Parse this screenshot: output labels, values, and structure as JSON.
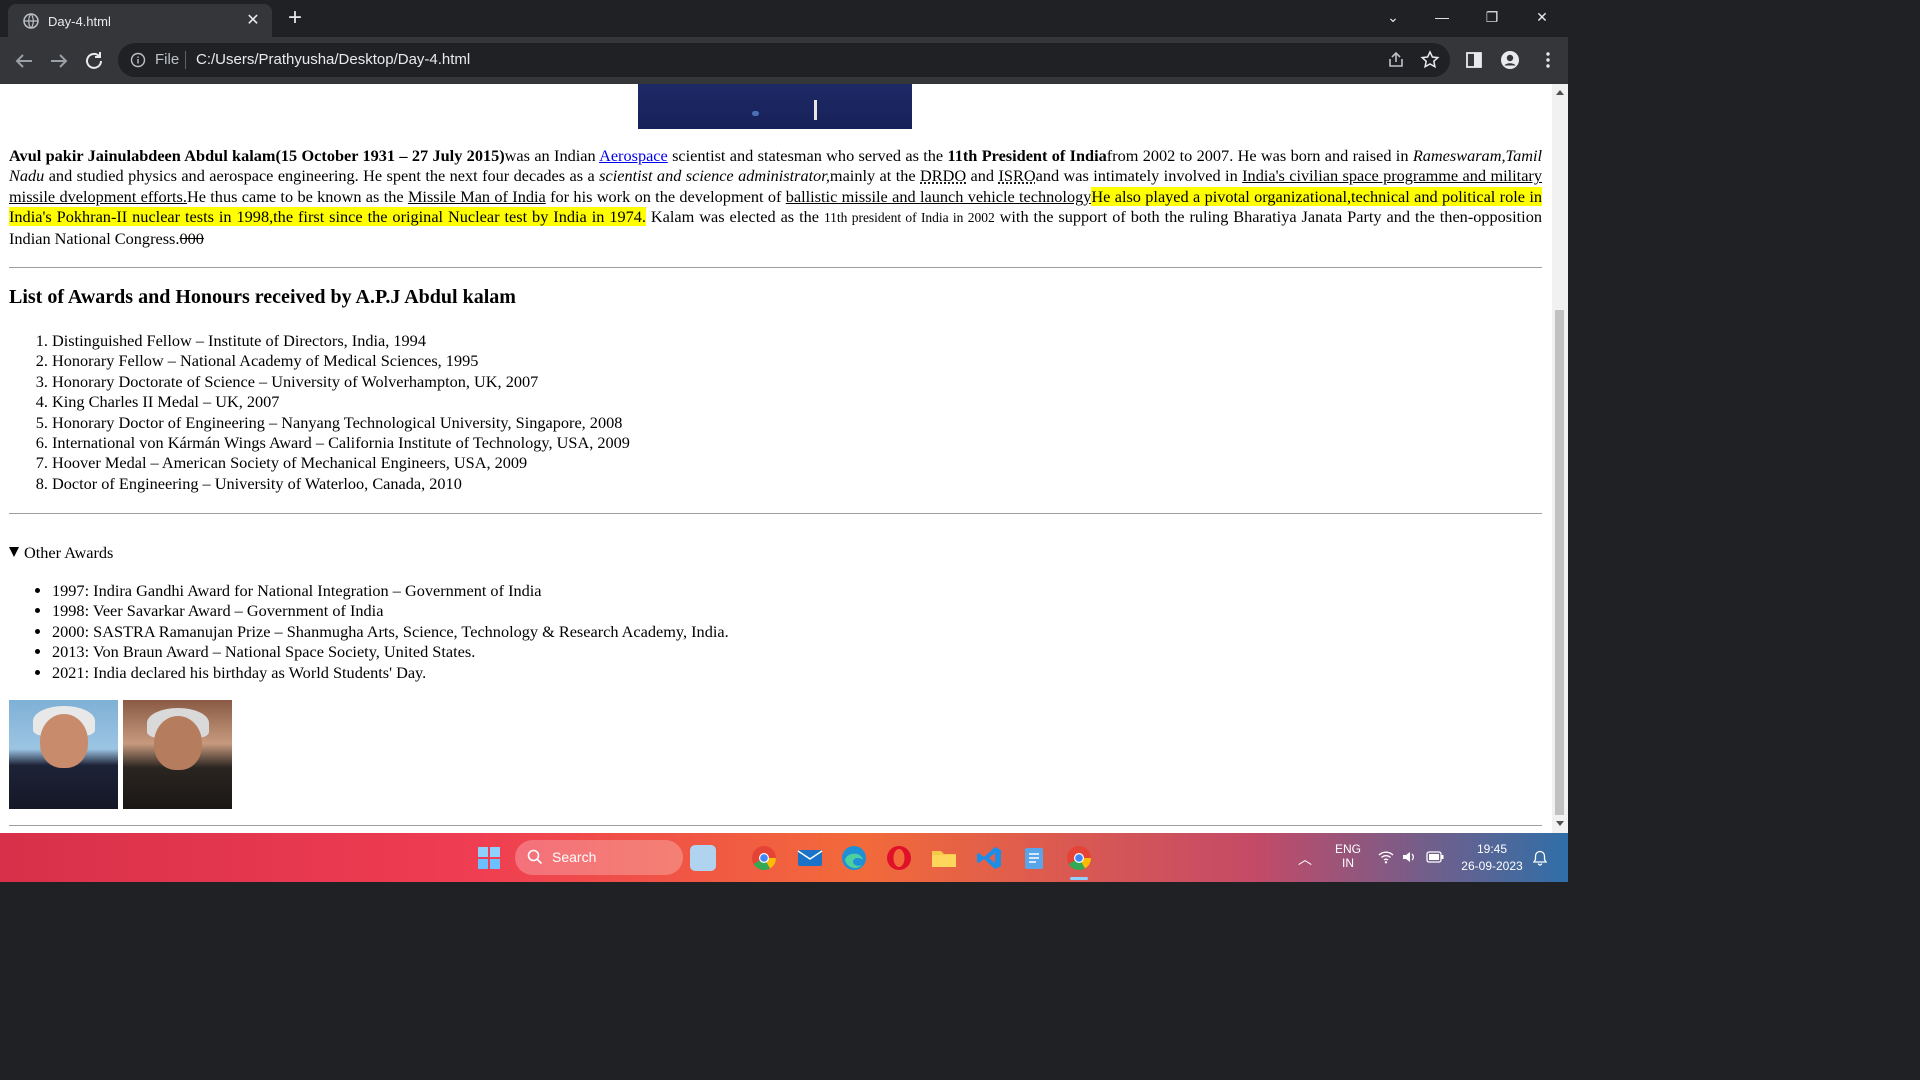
{
  "browser": {
    "tab_title": "Day-4.html",
    "omnibox_scheme": "File",
    "omnibox_url": "C:/Users/Prathyusha/Desktop/Day-4.html"
  },
  "intro": {
    "name_bold": "Avul pakir Jainulabdeen Abdul kalam(15 October 1931 – 27 July 2015)",
    "t1": "was an Indian ",
    "aerospace_link": "Aerospace",
    "t2": " scientist and statesman who served as the ",
    "president_bold": "11th President of India",
    "t3": "from 2002 to 2007. He was born and raised in ",
    "birthplace_italic": "Rameswaram,Tamil Nadu",
    "t4": " and studied physics and aerospace engineering. He spent the next four decades as a ",
    "role_italic": "scientist and science administrator,",
    "t5": "mainly at the ",
    "drdo": "DRDO",
    "t6": " and ",
    "isro": "ISRO",
    "t7": "and was intimately involved in ",
    "civilian_underline": "India's civilian space programme and military missile dvelopment efforts.",
    "t8": "He thus came to be known as the ",
    "missile_man_underline": "Missile Man of India",
    "t9": " for his work on the development of ",
    "ballistic_underline": "ballistic missile and launch vehicle technology",
    "highlight": "He also played a pivotal organizational,technical and political role in India's Pokhran-II nuclear tests in 1998,the first since the original Nuclear test by India in 1974.",
    "t10": " Kalam was elected as the ",
    "small_text": "11th president of India in 2002",
    "t11": " with the support of both the ruling Bharatiya Janata Party and the then-opposition Indian National Congress.",
    "strike": "000"
  },
  "awards": {
    "heading": "List of Awards and Honours received by A.P.J Abdul kalam",
    "items": [
      "Distinguished Fellow – Institute of Directors, India, 1994",
      "Honorary Fellow – National Academy of Medical Sciences, 1995",
      "Honorary Doctorate of Science – University of Wolverhampton, UK, 2007",
      "King Charles II Medal – UK, 2007",
      "Honorary Doctor of Engineering – Nanyang Technological University, Singapore, 2008",
      "International von Kármán Wings Award – California Institute of Technology, USA, 2009",
      "Hoover Medal – American Society of Mechanical Engineers, USA, 2009",
      "Doctor of Engineering – University of Waterloo, Canada, 2010"
    ]
  },
  "other_awards": {
    "summary": "Other Awards",
    "items": [
      "1997: Indira Gandhi Award for National Integration – Government of India",
      "1998: Veer Savarkar Award – Government of India",
      "2000: SASTRA Ramanujan Prize – Shanmugha Arts, Science, Technology & Research Academy, India.",
      "2013: Von Braun Award – National Space Society, United States.",
      "2021: India declared his birthday as World Students' Day."
    ]
  },
  "taskbar": {
    "search_label": "Search",
    "lang_line1": "ENG",
    "lang_line2": "IN",
    "time": "19:45",
    "date": "26-09-2023"
  }
}
